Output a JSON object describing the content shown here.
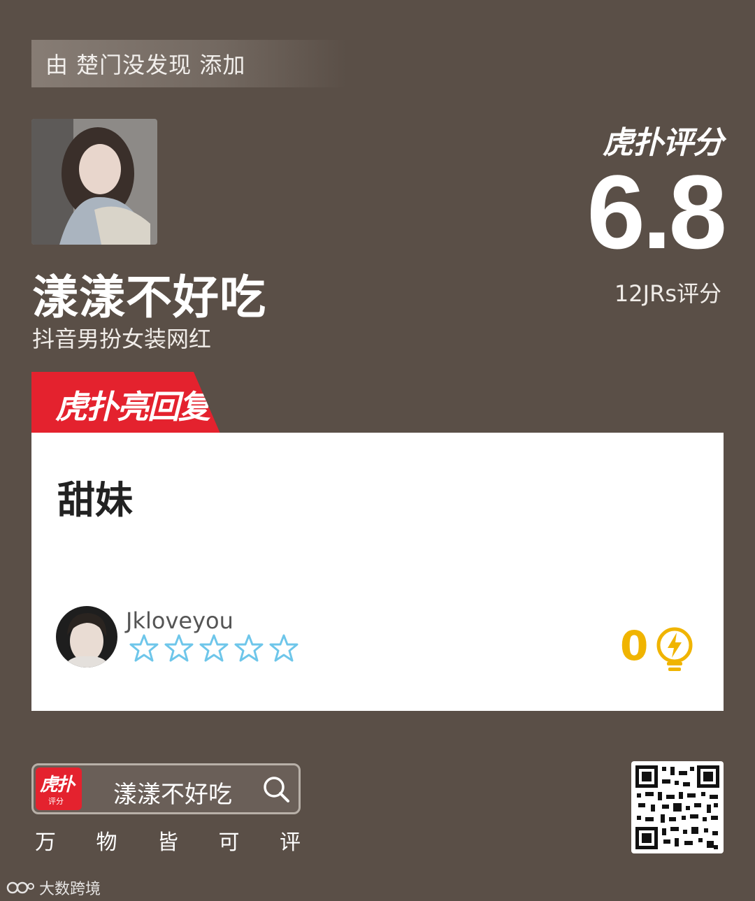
{
  "added_by": "由 楚门没发现 添加",
  "subject": {
    "name": "漾漾不好吃",
    "description": "抖音男扮女装网红"
  },
  "rating": {
    "brand": "虎扑评分",
    "score": "6.8",
    "count_label": "12JRs评分"
  },
  "reply_section": {
    "tag": "虎扑亮回复",
    "comment": "甜妹",
    "user": "Jkloveyou",
    "stars_filled": 0,
    "stars_total": 5,
    "likes": "0"
  },
  "footer": {
    "app_icon_text": "虎扑",
    "app_icon_sub": "评分",
    "search_text": "漾漾不好吃",
    "slogan": [
      "万",
      "物",
      "皆",
      "可",
      "评"
    ],
    "watermark": "大数跨境"
  },
  "colors": {
    "background": "#5a4f47",
    "accent_red": "#e4222e",
    "like_yellow": "#f0b400",
    "star_blue": "#6ec6ea"
  }
}
